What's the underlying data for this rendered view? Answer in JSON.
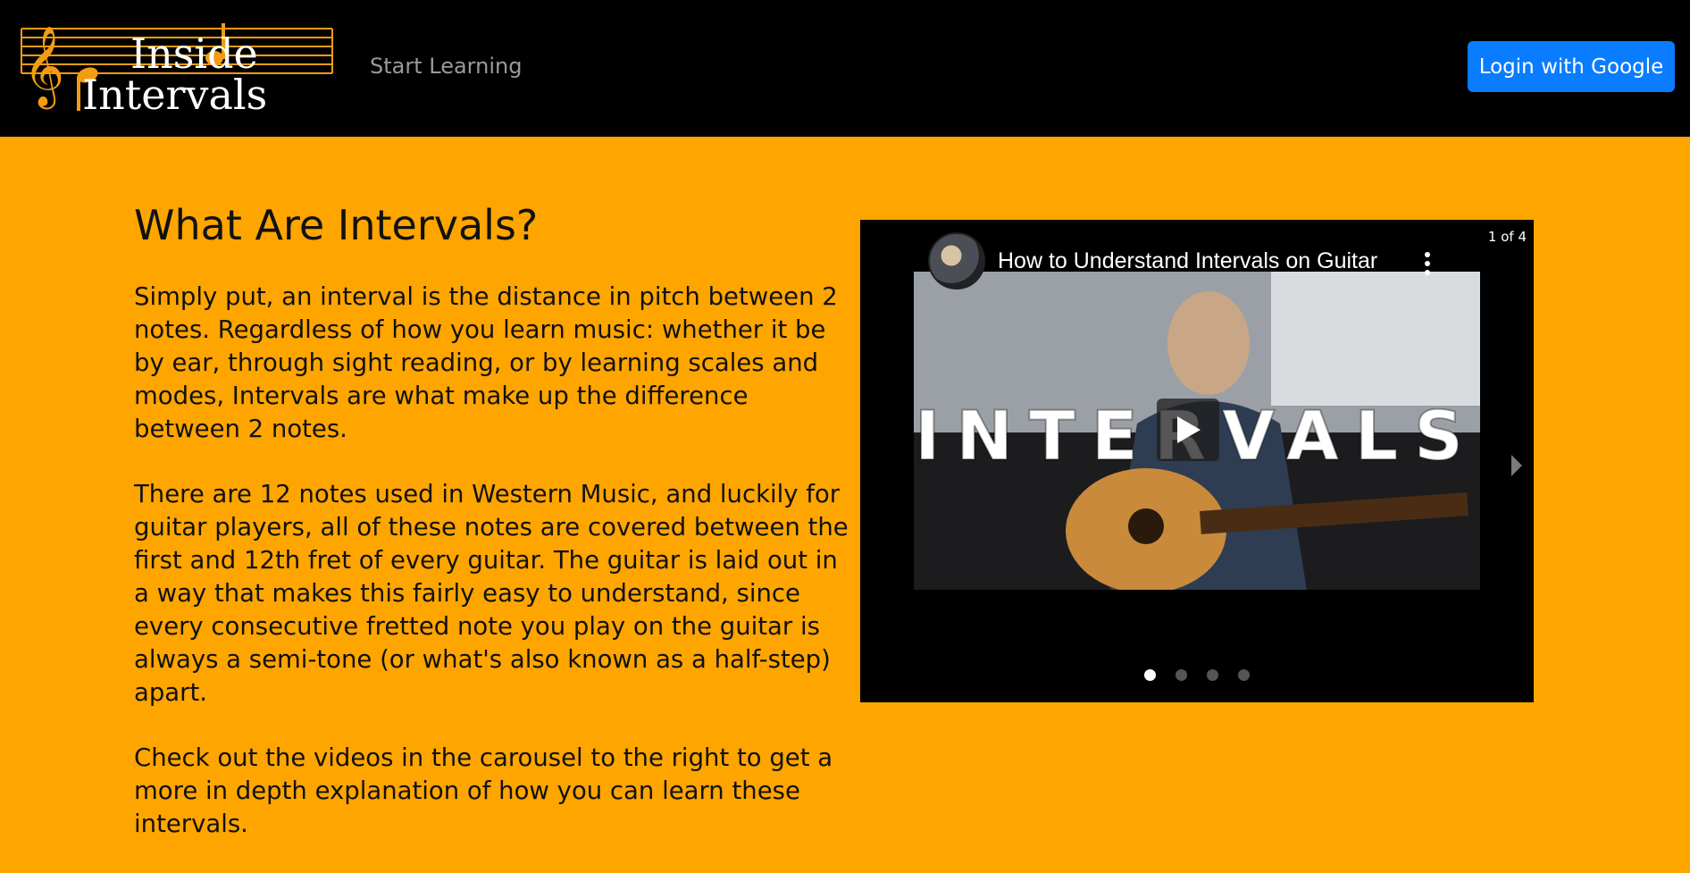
{
  "navbar": {
    "logo_text_line1": "Inside",
    "logo_text_line2": "Intervals",
    "nav_link": "Start Learning",
    "login_label": "Login with Google"
  },
  "content": {
    "title": "What Are Intervals?",
    "paragraphs": [
      "Simply put, an interval is the distance in pitch between 2 notes. Regardless of how you learn music: whether it be by ear, through sight reading, or by learning scales and modes, Intervals are what make up the difference between 2 notes.",
      "There are 12 notes used in Western Music, and luckily for guitar players, all of these notes are covered between the first and 12th fret of every guitar. The guitar is laid out in a way that makes this fairly easy to understand, since every consecutive fretted note you play on the guitar is always a semi-tone (or what's also known as a half-step) apart.",
      "Check out the videos in the carousel to the right to get a more in depth explanation of how you can learn these intervals."
    ]
  },
  "carousel": {
    "counter": "1 of 4",
    "video_title": "How to Understand Intervals on Guitar",
    "thumbnail_text": "INTERVALS",
    "slides_total": 4,
    "active_slide": 1
  },
  "colors": {
    "page_bg": "#FFA500",
    "navbar_bg": "#000000",
    "accent_orange": "#F39C12",
    "login_blue": "#0A7CFF"
  },
  "icons": [
    "treble-clef-icon",
    "music-note-icon",
    "play-icon",
    "kebab-menu-icon",
    "chevron-right-icon"
  ]
}
